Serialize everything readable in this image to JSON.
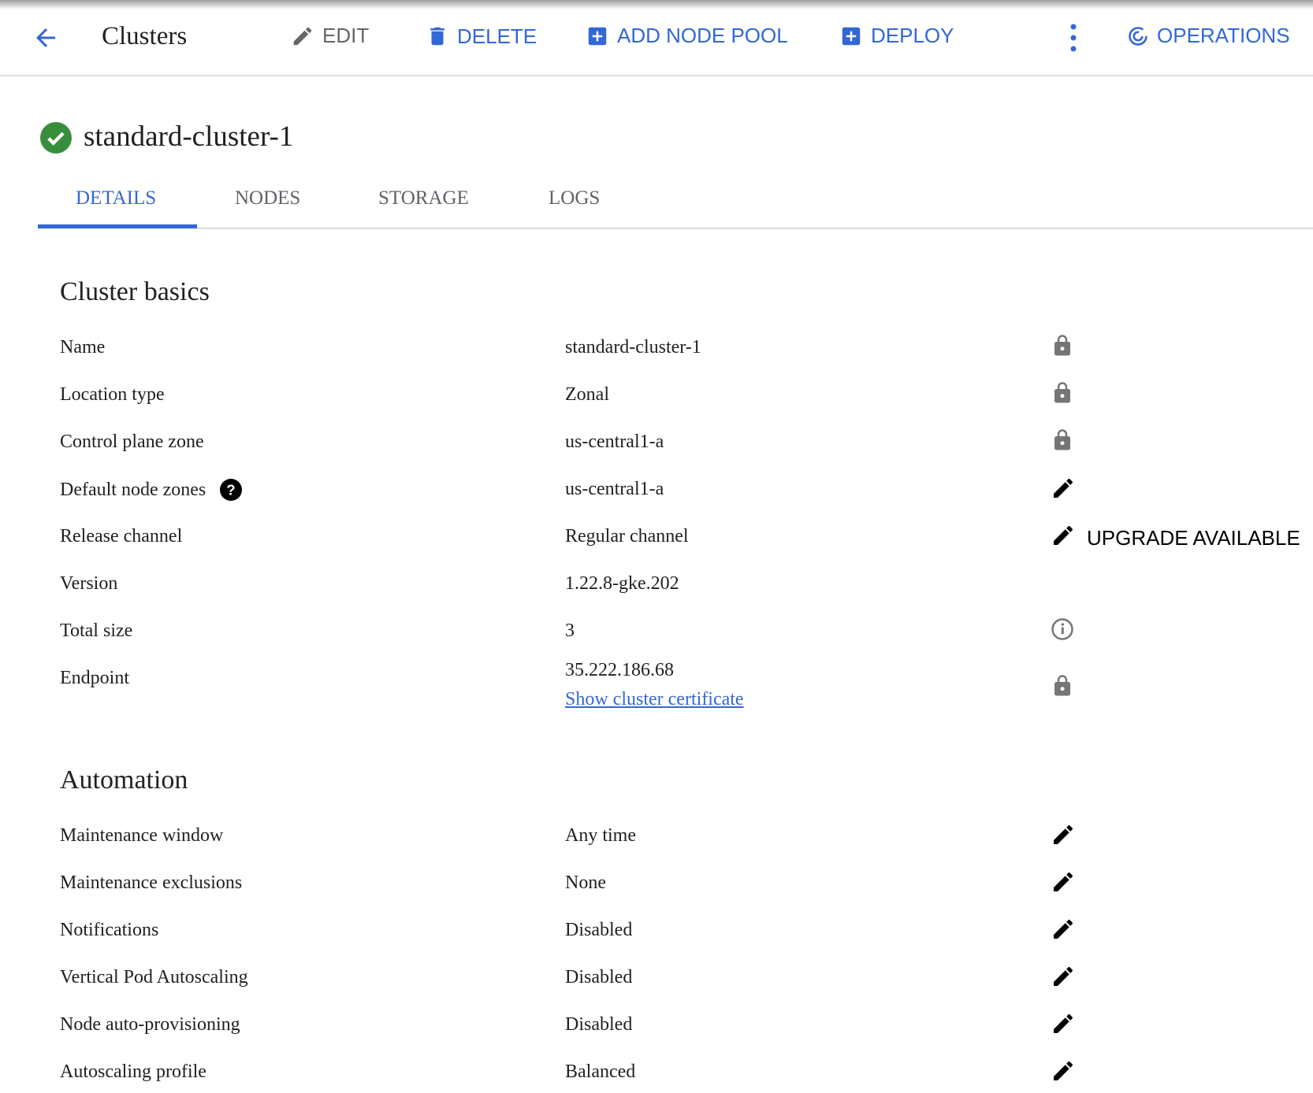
{
  "header": {
    "title": "Clusters",
    "edit": "EDIT",
    "delete": "DELETE",
    "add_node_pool": "ADD NODE POOL",
    "deploy": "DEPLOY",
    "operations": "OPERATIONS"
  },
  "cluster": {
    "name": "standard-cluster-1",
    "status": "ok"
  },
  "tabs": [
    {
      "label": "DETAILS",
      "active": true
    },
    {
      "label": "NODES"
    },
    {
      "label": "STORAGE"
    },
    {
      "label": "LOGS"
    }
  ],
  "basics": {
    "heading": "Cluster basics",
    "rows": [
      {
        "label": "Name",
        "value": "standard-cluster-1",
        "icon": "lock-icon"
      },
      {
        "label": "Location type",
        "value": "Zonal",
        "icon": "lock-icon"
      },
      {
        "label": "Control plane zone",
        "value": "us-central1-a",
        "icon": "lock-icon"
      },
      {
        "label": "Default node zones",
        "value": "us-central1-a",
        "icon": "edit-icon",
        "help": true
      },
      {
        "label": "Release channel",
        "value": "Regular channel",
        "icon": "edit-icon",
        "action": "UPGRADE AVAILABLE"
      },
      {
        "label": "Version",
        "value": "1.22.8-gke.202"
      },
      {
        "label": "Total size",
        "value": "3",
        "icon": "info-icon"
      },
      {
        "label": "Endpoint",
        "value": "35.222.186.68",
        "link": "Show cluster certificate",
        "icon": "lock-icon"
      }
    ]
  },
  "automation": {
    "heading": "Automation",
    "rows": [
      {
        "label": "Maintenance window",
        "value": "Any time",
        "icon": "edit-icon"
      },
      {
        "label": "Maintenance exclusions",
        "value": "None",
        "icon": "edit-icon"
      },
      {
        "label": "Notifications",
        "value": "Disabled",
        "icon": "edit-icon"
      },
      {
        "label": "Vertical Pod Autoscaling",
        "value": "Disabled",
        "icon": "edit-icon"
      },
      {
        "label": "Node auto-provisioning",
        "value": "Disabled",
        "icon": "edit-icon"
      },
      {
        "label": "Autoscaling profile",
        "value": "Balanced",
        "icon": "edit-icon"
      }
    ]
  },
  "colors": {
    "accent": "#3367d6",
    "success": "#388e3c",
    "icon_gray": "#757575"
  }
}
